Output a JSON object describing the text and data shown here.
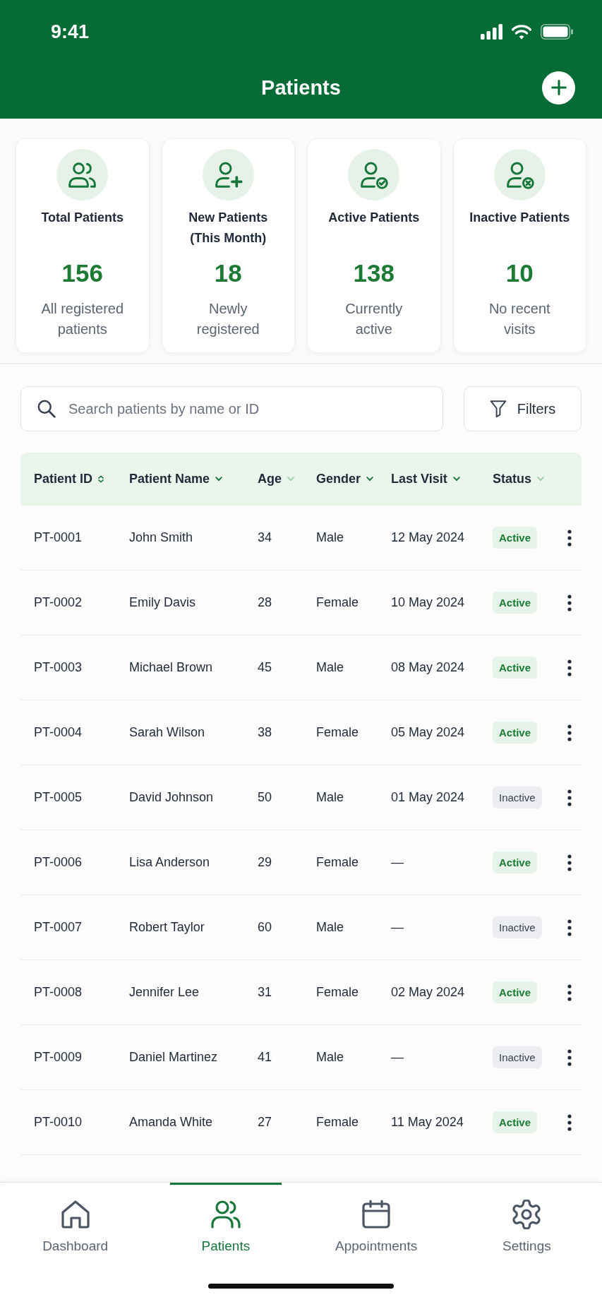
{
  "status_bar": {
    "time": "9:41"
  },
  "header": {
    "title": "Patients"
  },
  "stats": [
    {
      "kind": "total",
      "title": "Total Patients",
      "value": "156",
      "caption": "All registered patients"
    },
    {
      "kind": "new",
      "title": "New Patients (This Month)",
      "value": "18",
      "caption": "Newly registered"
    },
    {
      "kind": "active",
      "title": "Active Patients",
      "value": "138",
      "caption": "Currently active"
    },
    {
      "kind": "inactive",
      "title": "Inactive Patients",
      "value": "10",
      "caption": "No recent visits"
    }
  ],
  "search": {
    "placeholder": "Search patients by name or ID"
  },
  "filters_button": {
    "label": "Filters"
  },
  "table": {
    "columns": [
      {
        "label": "Patient ID",
        "kind": "updown",
        "highlighted": true
      },
      {
        "label": "Patient Name",
        "kind": "down",
        "highlighted": true
      },
      {
        "label": "Age",
        "kind": "down",
        "highlighted": false
      },
      {
        "label": "Gender",
        "kind": "down",
        "highlighted": true
      },
      {
        "label": "Last Visit",
        "kind": "down",
        "highlighted": true
      },
      {
        "label": "Status",
        "kind": "down",
        "highlighted": false
      }
    ],
    "rows": [
      {
        "id": "PT-0001",
        "name": "John Smith",
        "age": "34",
        "gender": "Male",
        "last_visit": "12 May 2024",
        "status": {
          "label": "Active",
          "kind": "active"
        }
      },
      {
        "id": "PT-0002",
        "name": "Emily Davis",
        "age": "28",
        "gender": "Female",
        "last_visit": "10 May 2024",
        "status": {
          "label": "Active",
          "kind": "active"
        }
      },
      {
        "id": "PT-0003",
        "name": "Michael Brown",
        "age": "45",
        "gender": "Male",
        "last_visit": "08 May 2024",
        "status": {
          "label": "Active",
          "kind": "active"
        }
      },
      {
        "id": "PT-0004",
        "name": "Sarah Wilson",
        "age": "38",
        "gender": "Female",
        "last_visit": "05 May 2024",
        "status": {
          "label": "Active",
          "kind": "active"
        }
      },
      {
        "id": "PT-0005",
        "name": "David Johnson",
        "age": "50",
        "gender": "Male",
        "last_visit": "01 May 2024",
        "status": {
          "label": "Inactive",
          "kind": "inactive"
        }
      },
      {
        "id": "PT-0006",
        "name": "Lisa Anderson",
        "age": "29",
        "gender": "Female",
        "last_visit": "—",
        "status": {
          "label": "Active",
          "kind": "active"
        }
      },
      {
        "id": "PT-0007",
        "name": "Robert Taylor",
        "age": "60",
        "gender": "Male",
        "last_visit": "—",
        "status": {
          "label": "Inactive",
          "kind": "inactive"
        }
      },
      {
        "id": "PT-0008",
        "name": "Jennifer Lee",
        "age": "31",
        "gender": "Female",
        "last_visit": "02 May 2024",
        "status": {
          "label": "Active",
          "kind": "active"
        }
      },
      {
        "id": "PT-0009",
        "name": "Daniel Martinez",
        "age": "41",
        "gender": "Male",
        "last_visit": "—",
        "status": {
          "label": "Inactive",
          "kind": "inactive"
        }
      },
      {
        "id": "PT-0010",
        "name": "Amanda White",
        "age": "27",
        "gender": "Female",
        "last_visit": "11 May 2024",
        "status": {
          "label": "Active",
          "kind": "active"
        }
      }
    ]
  },
  "bottom_nav": [
    {
      "kind": "dashboard",
      "label": "Dashboard",
      "selected": false
    },
    {
      "kind": "patients",
      "label": "Patients",
      "selected": true
    },
    {
      "kind": "appointments",
      "label": "Appointments",
      "selected": false
    },
    {
      "kind": "settings",
      "label": "Settings",
      "selected": false
    }
  ]
}
